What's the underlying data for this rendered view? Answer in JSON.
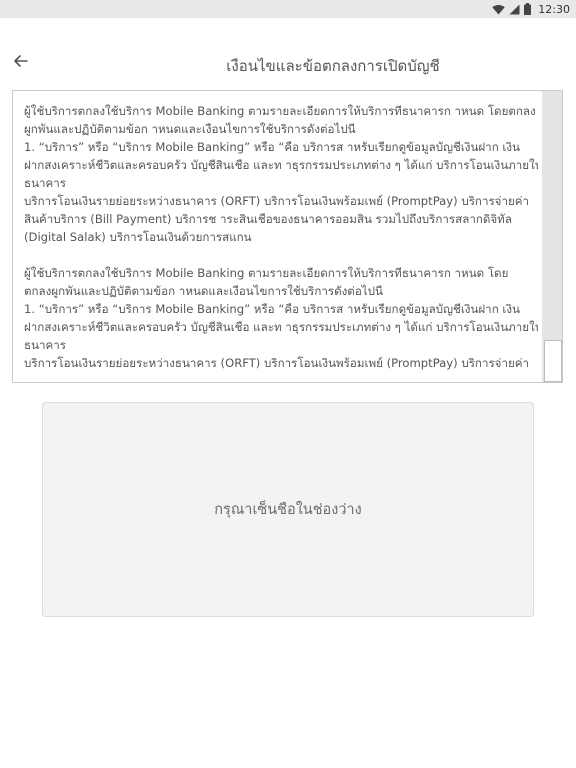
{
  "status_bar": {
    "time": "12:30",
    "icons": [
      "wifi-icon",
      "signal-icon",
      "battery-icon"
    ]
  },
  "header": {
    "back_icon": "arrow-left-icon",
    "title": "เงือนไขและข้อตกลงการเปิดบัญชี"
  },
  "terms": {
    "paragraphs": [
      [
        "ผู้ใช้บริการตกลงใช้บริการ Mobile Banking ตามรายละเอียดการให้บริการทีธนาคารก าหนด โดยตกลง",
        "ผูกพันและปฏิบัติตามข้อก าหนดและเงือนไขการใช้บริการดังต่อไปนี",
        "1. “บริการ” หรือ “บริการ Mobile Banking” หรือ “คือ บริการส าหรับเรียกดูข้อมูลบัญชีเงินฝาก เงิน",
        "ฝากสงเคราะห์ชีวิตและครอบครัว บัญชีสินเชือ และท าธุรกรรมประเภทต่าง ๆ ได้แก่ บริการโอนเงินภายใน",
        "ธนาคาร",
        "บริการโอนเงินรายย่อยระหว่างธนาคาร (ORFT) บริการโอนเงินพร้อมเพย์ (PromptPay) บริการจ่ายค่า",
        "สินค้าบริการ (Bill Payment) บริการช าระสินเชือของธนาคารออมสิน รวมไปถึงบริการสลากดิจิทัล",
        "(Digital Salak) บริการโอนเงินด้วยการสแกน"
      ],
      [
        "ผู้ใช้บริการตกลงใช้บริการ Mobile Banking ตามรายละเอียดการให้บริการทีธนาคารก าหนด โดย",
        "ตกลงผูกพันและปฏิบัติตามข้อก าหนดและเงือนไขการใช้บริการดังต่อไปนี",
        "1. “บริการ” หรือ “บริการ Mobile Banking” หรือ “คือ บริการส าหรับเรียกดูข้อมูลบัญชีเงินฝาก เงิน",
        "ฝากสงเคราะห์ชีวิตและครอบครัว บัญชีสินเชือ และท าธุรกรรมประเภทต่าง ๆ ได้แก่ บริการโอนเงินภายใน",
        "ธนาคาร",
        "บริการโอนเงินรายย่อยระหว่างธนาคาร (ORFT) บริการโอนเงินพร้อมเพย์ (PromptPay) บริการจ่ายค่า"
      ]
    ]
  },
  "signature": {
    "placeholder": "กรุณาเซ็นชือในช่องว่าง"
  }
}
